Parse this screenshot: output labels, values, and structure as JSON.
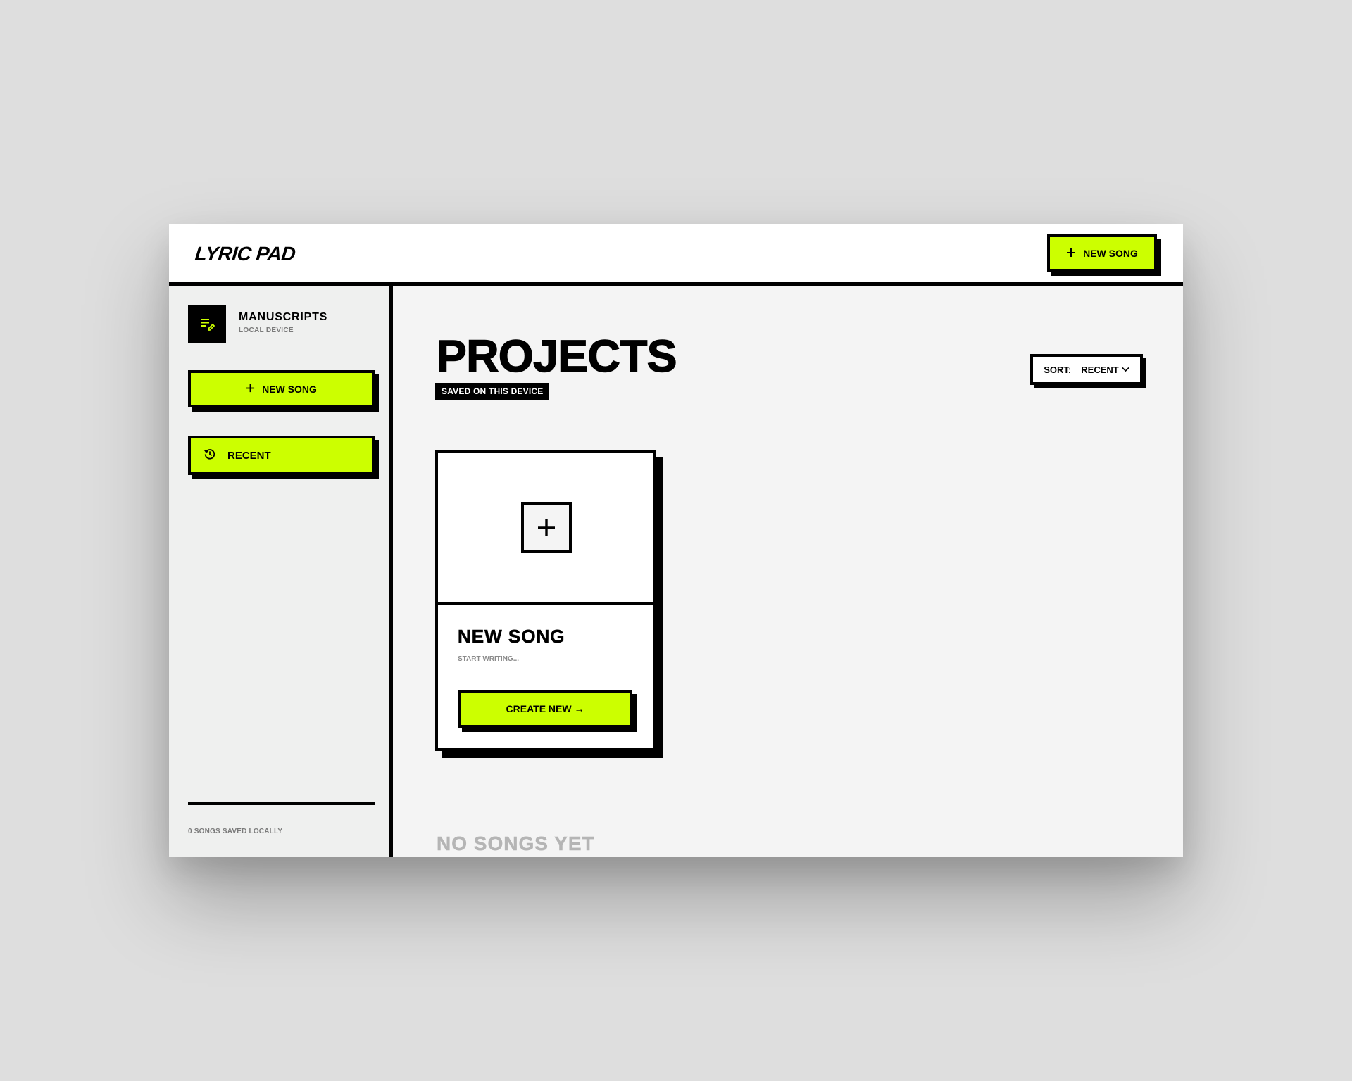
{
  "header": {
    "logo": "LYRIC PAD",
    "new_song_label": "NEW SONG"
  },
  "sidebar": {
    "brand_title": "MANUSCRIPTS",
    "brand_subtitle": "LOCAL DEVICE",
    "new_song_label": "NEW SONG",
    "recent_label": "RECENT",
    "footer_count": "0 SONGS SAVED LOCALLY"
  },
  "main": {
    "title": "PROJECTS",
    "badge": "SAVED ON THIS DEVICE",
    "sort_label": "SORT:",
    "sort_value": "RECENT",
    "card": {
      "title": "NEW SONG",
      "subtitle": "START WRITING...",
      "button_label": "CREATE NEW →"
    },
    "empty_state": "NO SONGS YET"
  },
  "colors": {
    "accent": "#ccff00",
    "ink": "#000000",
    "background": "#f4f4f4",
    "sidebar": "#eff0ef",
    "muted": "#b5b5b5"
  },
  "icons": {
    "brand": "edit-note-icon",
    "plus": "plus-icon",
    "recent": "history-icon",
    "sort_chevron": "chevron-down-icon"
  }
}
